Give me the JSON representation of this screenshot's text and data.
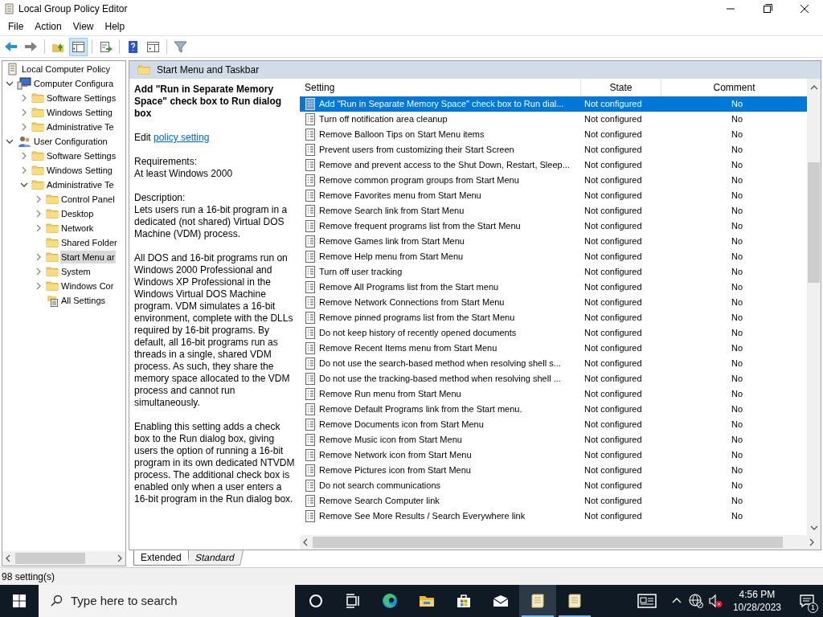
{
  "window": {
    "title": "Local Group Policy Editor"
  },
  "menu": [
    "File",
    "Action",
    "View",
    "Help"
  ],
  "toolbar": [
    {
      "kind": "back",
      "pressed": false
    },
    {
      "kind": "forward",
      "pressed": false
    },
    {
      "kind": "sep"
    },
    {
      "kind": "up",
      "pressed": false
    },
    {
      "kind": "tree",
      "pressed": true
    },
    {
      "kind": "sep"
    },
    {
      "kind": "export",
      "pressed": false
    },
    {
      "kind": "sep"
    },
    {
      "kind": "help",
      "pressed": false
    },
    {
      "kind": "pane",
      "pressed": false
    },
    {
      "kind": "sep"
    },
    {
      "kind": "filter",
      "pressed": false
    }
  ],
  "tree": [
    {
      "label": "Local Computer Policy",
      "kind": "policy",
      "selected": false,
      "children": [
        {
          "label": "Computer Configura",
          "kind": "computer",
          "leaf": false,
          "expanded": true,
          "selected": false,
          "children": [
            {
              "label": "Software Settings",
              "kind": "folder",
              "leaf": false,
              "expanded": false,
              "selected": false
            },
            {
              "label": "Windows Setting",
              "kind": "folder",
              "leaf": false,
              "expanded": false,
              "selected": false
            },
            {
              "label": "Administrative Te",
              "kind": "folder",
              "leaf": false,
              "expanded": false,
              "selected": false
            }
          ]
        },
        {
          "label": "User Configuration",
          "kind": "user",
          "leaf": false,
          "expanded": true,
          "selected": false,
          "children": [
            {
              "label": "Software Settings",
              "kind": "folder",
              "leaf": false,
              "expanded": false,
              "selected": false
            },
            {
              "label": "Windows Setting",
              "kind": "folder",
              "leaf": false,
              "expanded": false,
              "selected": false
            },
            {
              "label": "Administrative Te",
              "kind": "folder",
              "leaf": false,
              "expanded": true,
              "selected": false,
              "children": [
                {
                  "label": "Control Panel",
                  "kind": "folder",
                  "leaf": false,
                  "expanded": false,
                  "selected": false
                },
                {
                  "label": "Desktop",
                  "kind": "folder",
                  "leaf": false,
                  "expanded": false,
                  "selected": false
                },
                {
                  "label": "Network",
                  "kind": "folder",
                  "leaf": false,
                  "expanded": false,
                  "selected": false
                },
                {
                  "label": "Shared Folder",
                  "kind": "folder",
                  "leaf": true,
                  "selected": false
                },
                {
                  "label": "Start Menu ar",
                  "kind": "folder",
                  "leaf": false,
                  "expanded": false,
                  "selected": true
                },
                {
                  "label": "System",
                  "kind": "folder",
                  "leaf": false,
                  "expanded": false,
                  "selected": false
                },
                {
                  "label": "Windows Cor",
                  "kind": "folder",
                  "leaf": false,
                  "expanded": false,
                  "selected": false
                },
                {
                  "label": "All Settings",
                  "kind": "all-settings",
                  "leaf": true,
                  "selected": false
                }
              ]
            }
          ]
        }
      ]
    }
  ],
  "details": {
    "heading": "Start Menu and Taskbar",
    "title": "Add \"Run in Separate Memory Space\" check box to Run dialog box",
    "edit_prefix": "Edit",
    "edit_link": "policy setting",
    "requirements_label": "Requirements:",
    "requirements": "At least Windows 2000",
    "description_label": "Description:",
    "paragraphs": [
      "Lets users run a 16-bit program in a dedicated (not shared) Virtual DOS Machine (VDM) process.",
      "All DOS and 16-bit programs run on Windows 2000 Professional and Windows XP Professional in the Windows Virtual DOS Machine program. VDM simulates a 16-bit environment, complete with the DLLs required by 16-bit programs. By default, all 16-bit programs run as threads in a single, shared VDM process. As such, they share the memory space allocated to the VDM process and cannot run simultaneously.",
      "Enabling this setting adds a check box to the Run dialog box, giving users the option of running a 16-bit program in its own dedicated NTVDM process. The additional check box is enabled only when a user enters a 16-bit program in the Run dialog box."
    ]
  },
  "table": {
    "columns": [
      "Setting",
      "State",
      "Comment"
    ],
    "rows": [
      {
        "setting": "Add \"Run in Separate Memory Space\" check box to Run dial...",
        "state": "Not configured",
        "comment": "No",
        "selected": true
      },
      {
        "setting": "Turn off notification area cleanup",
        "state": "Not configured",
        "comment": "No",
        "selected": false
      },
      {
        "setting": "Remove Balloon Tips on Start Menu items",
        "state": "Not configured",
        "comment": "No",
        "selected": false
      },
      {
        "setting": "Prevent users from customizing their Start Screen",
        "state": "Not configured",
        "comment": "No",
        "selected": false
      },
      {
        "setting": "Remove and prevent access to the Shut Down, Restart, Sleep...",
        "state": "Not configured",
        "comment": "No",
        "selected": false
      },
      {
        "setting": "Remove common program groups from Start Menu",
        "state": "Not configured",
        "comment": "No",
        "selected": false
      },
      {
        "setting": "Remove Favorites menu from Start Menu",
        "state": "Not configured",
        "comment": "No",
        "selected": false
      },
      {
        "setting": "Remove Search link from Start Menu",
        "state": "Not configured",
        "comment": "No",
        "selected": false
      },
      {
        "setting": "Remove frequent programs list from the Start Menu",
        "state": "Not configured",
        "comment": "No",
        "selected": false
      },
      {
        "setting": "Remove Games link from Start Menu",
        "state": "Not configured",
        "comment": "No",
        "selected": false
      },
      {
        "setting": "Remove Help menu from Start Menu",
        "state": "Not configured",
        "comment": "No",
        "selected": false
      },
      {
        "setting": "Turn off user tracking",
        "state": "Not configured",
        "comment": "No",
        "selected": false
      },
      {
        "setting": "Remove All Programs list from the Start menu",
        "state": "Not configured",
        "comment": "No",
        "selected": false
      },
      {
        "setting": "Remove Network Connections from Start Menu",
        "state": "Not configured",
        "comment": "No",
        "selected": false
      },
      {
        "setting": "Remove pinned programs list from the Start Menu",
        "state": "Not configured",
        "comment": "No",
        "selected": false
      },
      {
        "setting": "Do not keep history of recently opened documents",
        "state": "Not configured",
        "comment": "No",
        "selected": false
      },
      {
        "setting": "Remove Recent Items menu from Start Menu",
        "state": "Not configured",
        "comment": "No",
        "selected": false
      },
      {
        "setting": "Do not use the search-based method when resolving shell s...",
        "state": "Not configured",
        "comment": "No",
        "selected": false
      },
      {
        "setting": "Do not use the tracking-based method when resolving shell ...",
        "state": "Not configured",
        "comment": "No",
        "selected": false
      },
      {
        "setting": "Remove Run menu from Start Menu",
        "state": "Not configured",
        "comment": "No",
        "selected": false
      },
      {
        "setting": "Remove Default Programs link from the Start menu.",
        "state": "Not configured",
        "comment": "No",
        "selected": false
      },
      {
        "setting": "Remove Documents icon from Start Menu",
        "state": "Not configured",
        "comment": "No",
        "selected": false
      },
      {
        "setting": "Remove Music icon from Start Menu",
        "state": "Not configured",
        "comment": "No",
        "selected": false
      },
      {
        "setting": "Remove Network icon from Start Menu",
        "state": "Not configured",
        "comment": "No",
        "selected": false
      },
      {
        "setting": "Remove Pictures icon from Start Menu",
        "state": "Not configured",
        "comment": "No",
        "selected": false
      },
      {
        "setting": "Do not search communications",
        "state": "Not configured",
        "comment": "No",
        "selected": false
      },
      {
        "setting": "Remove Search Computer link",
        "state": "Not configured",
        "comment": "No",
        "selected": false
      },
      {
        "setting": "Remove See More Results / Search Everywhere link",
        "state": "Not configured",
        "comment": "No",
        "selected": false
      }
    ]
  },
  "view_tabs": [
    {
      "label": "Extended",
      "selected": true
    },
    {
      "label": "Standard",
      "selected": false
    }
  ],
  "status_bar": "98 setting(s)",
  "taskbar": {
    "search_placeholder": "Type here to search",
    "apps": [
      {
        "kind": "cortana",
        "running": false,
        "active": false
      },
      {
        "kind": "task-view",
        "running": false,
        "active": false
      },
      {
        "kind": "edge",
        "running": false,
        "active": false
      },
      {
        "kind": "explorer",
        "running": false,
        "active": false
      },
      {
        "kind": "store",
        "running": false,
        "active": false
      },
      {
        "kind": "mail",
        "running": false,
        "active": false
      },
      {
        "kind": "scroll",
        "running": true,
        "active": true
      },
      {
        "kind": "scroll",
        "running": true,
        "active": false
      }
    ],
    "time": "4:56 PM",
    "date": "10/28/2023",
    "notifications": "1"
  }
}
